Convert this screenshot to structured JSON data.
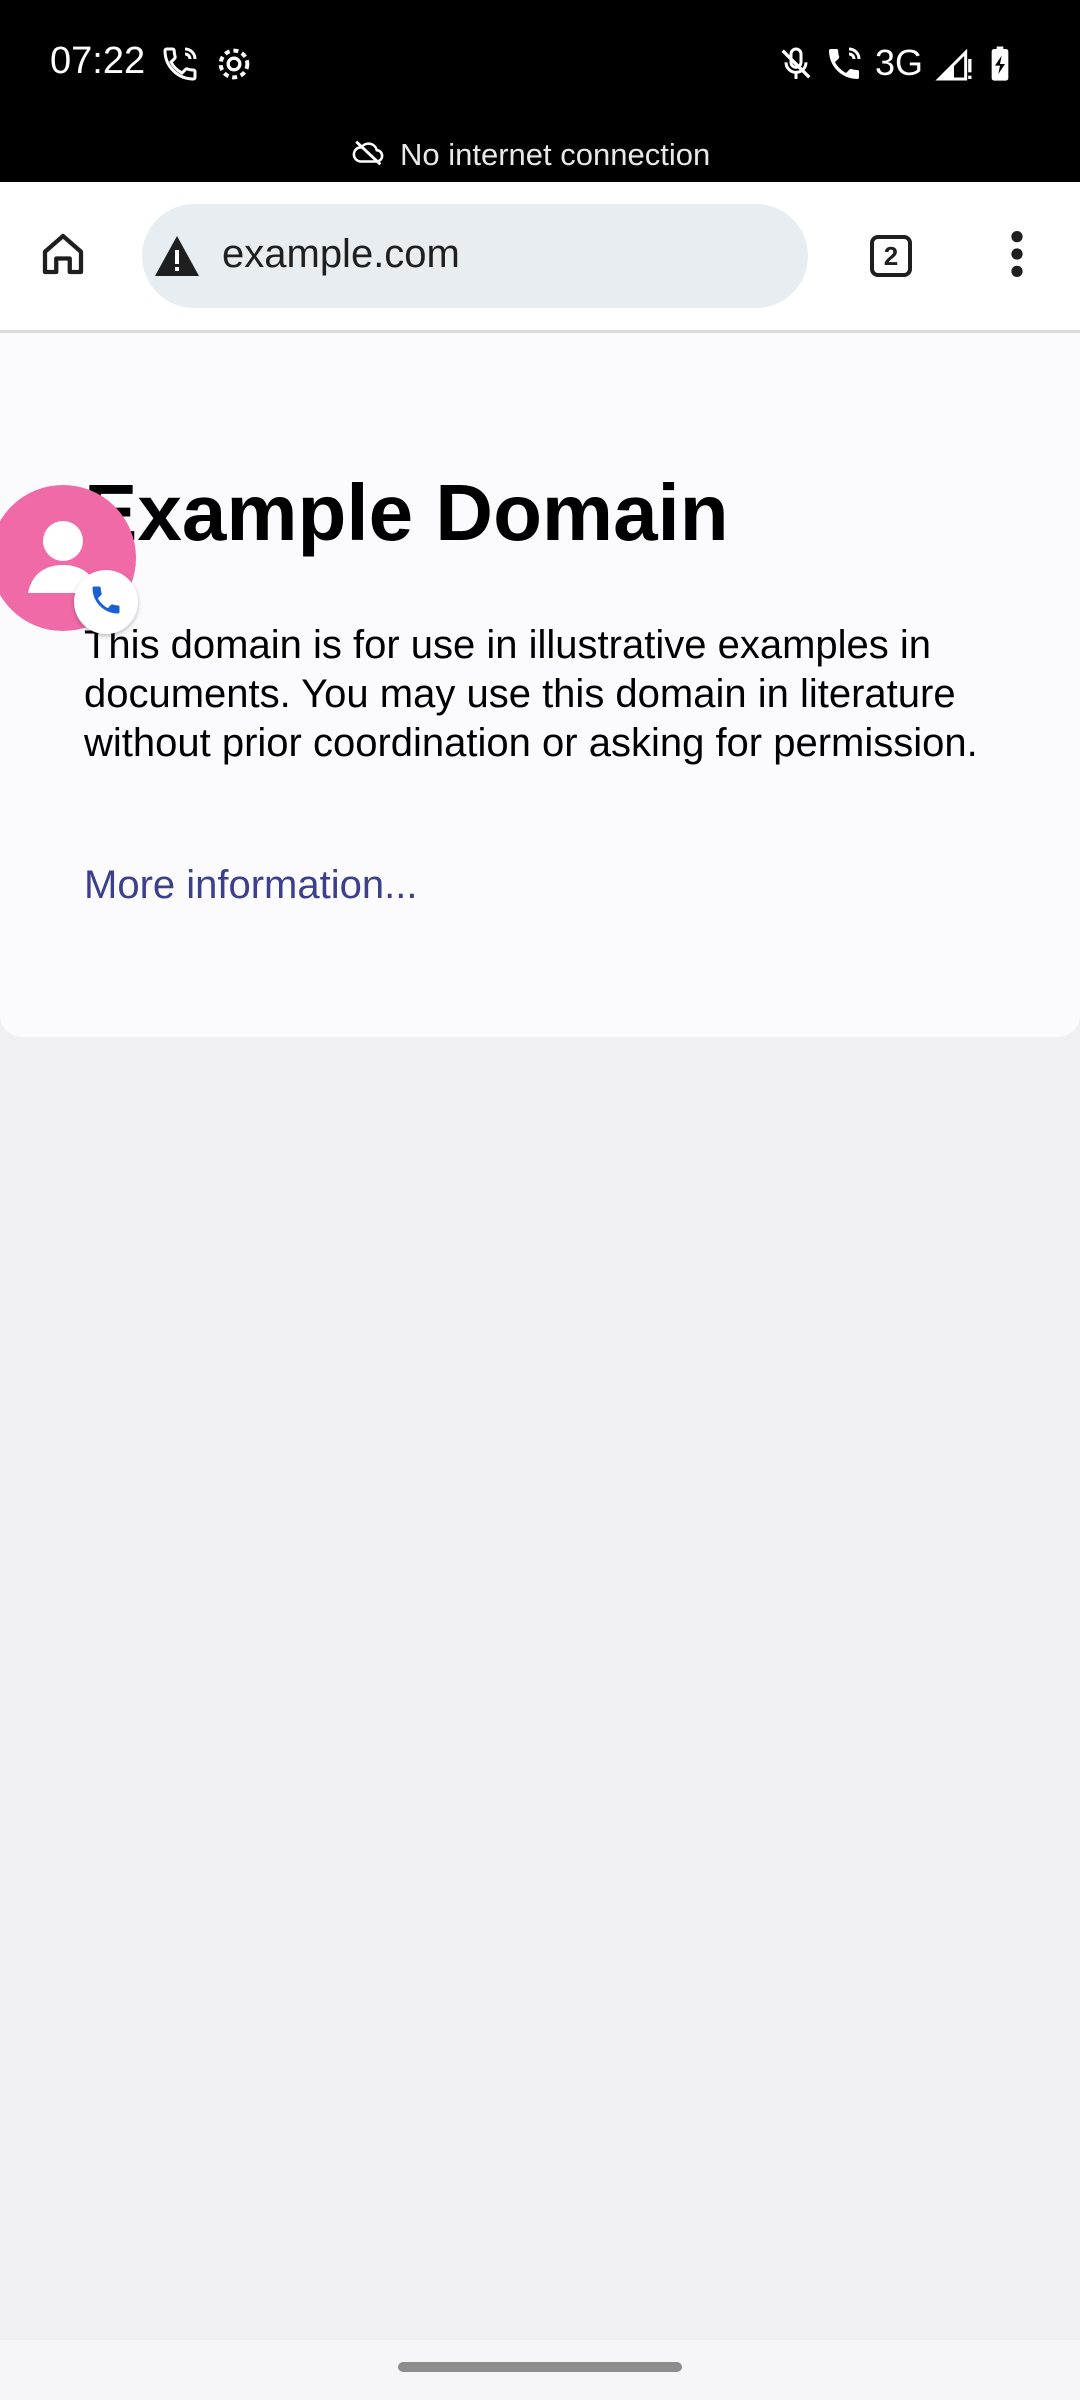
{
  "status_bar": {
    "time": "07:22",
    "left_icons": [
      "wifi-call-icon",
      "settings-gear-icon"
    ],
    "right_icons": [
      "mic-off-icon",
      "wifi-call-icon",
      "signal-icon",
      "battery-charging-icon"
    ],
    "network": "3G"
  },
  "offline_banner": {
    "icon": "cloud-off-icon",
    "text": "No internet connection"
  },
  "toolbar": {
    "home_icon": "home-icon",
    "security_icon": "warning-icon",
    "url": "example.com",
    "tab_count": "2",
    "menu_icon": "more-vert-icon"
  },
  "page": {
    "title": "Example Domain",
    "body": "This domain is for use in illustrative examples in documents. You may use this domain in literature without prior coordination or asking for permission.",
    "link": "More information..."
  },
  "chat_head": {
    "icon": "avatar-icon",
    "badge_icon": "phone-icon",
    "color": "#f06aa8"
  }
}
